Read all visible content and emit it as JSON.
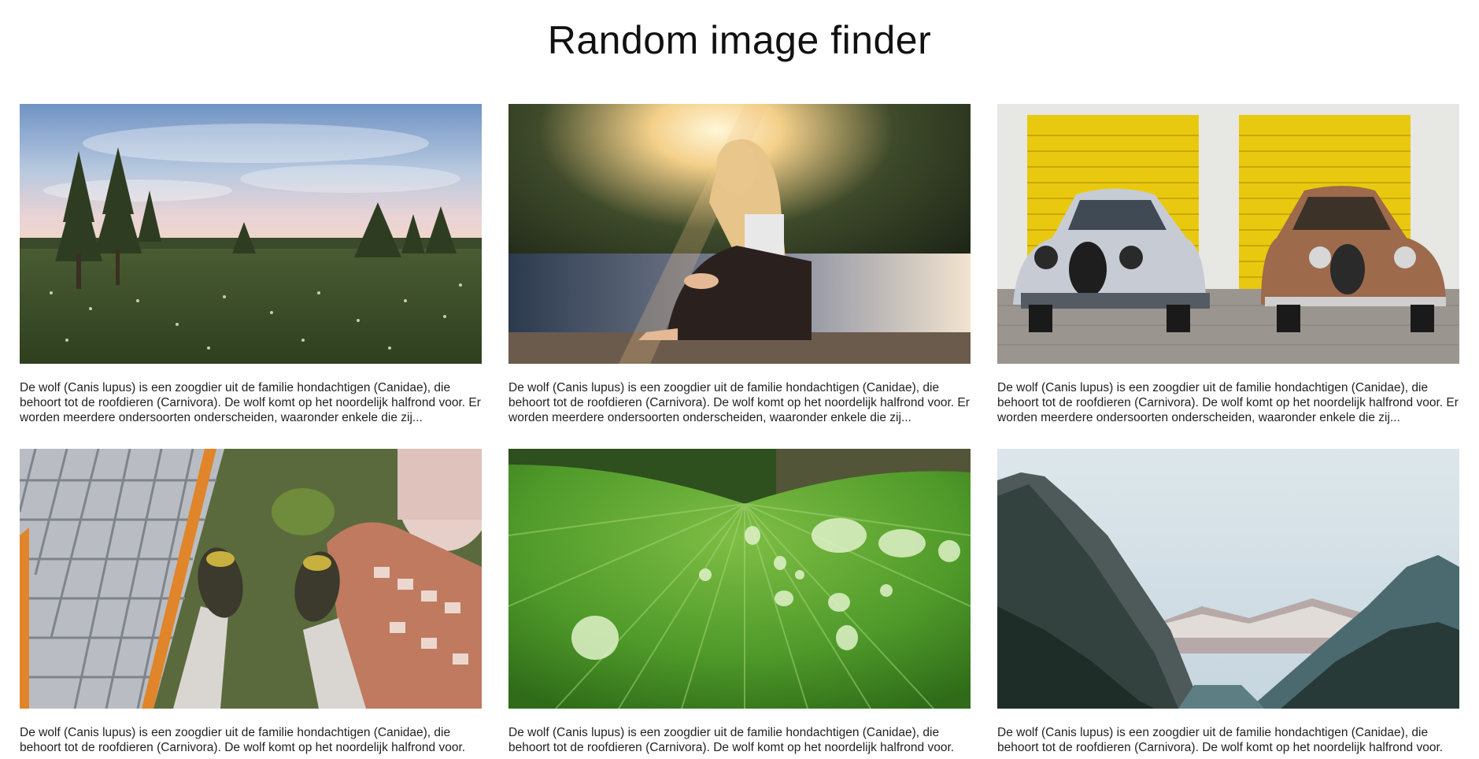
{
  "page": {
    "title": "Random image finder"
  },
  "cards": [
    {
      "image": "meadow-landscape-photo",
      "description": "De wolf (Canis lupus) is een zoogdier uit de familie hondachtigen (Canidae), die behoort tot de roofdieren (Carnivora). De wolf komt op het noordelijk halfrond voor. Er worden meerdere ondersoorten onderscheiden, waaronder enkele die zij..."
    },
    {
      "image": "woman-sunset-lake-photo",
      "description": "De wolf (Canis lupus) is een zoogdier uit de familie hondachtigen (Canidae), die behoort tot de roofdieren (Carnivora). De wolf komt op het noordelijk halfrond voor. Er worden meerdere ondersoorten onderscheiden, waaronder enkele die zij..."
    },
    {
      "image": "vintage-cars-yellow-doors-photo",
      "description": "De wolf (Canis lupus) is een zoogdier uit de familie hondachtigen (Canidae), die behoort tot de roofdieren (Carnivora). De wolf komt op het noordelijk halfrond voor. Er worden meerdere ondersoorten onderscheiden, waaronder enkele die zij..."
    },
    {
      "image": "feet-over-city-buildings-photo",
      "description": "De wolf (Canis lupus) is een zoogdier uit de familie hondachtigen (Canidae), die behoort tot de roofdieren (Carnivora). De wolf komt op het noordelijk halfrond voor."
    },
    {
      "image": "green-leaf-water-drops-photo",
      "description": "De wolf (Canis lupus) is een zoogdier uit de familie hondachtigen (Canidae), die behoort tot de roofdieren (Carnivora). De wolf komt op het noordelijk halfrond voor."
    },
    {
      "image": "mountain-valley-photo",
      "description": "De wolf (Canis lupus) is een zoogdier uit de familie hondachtigen (Canidae), die behoort tot de roofdieren (Carnivora). De wolf komt op het noordelijk halfrond voor."
    }
  ]
}
